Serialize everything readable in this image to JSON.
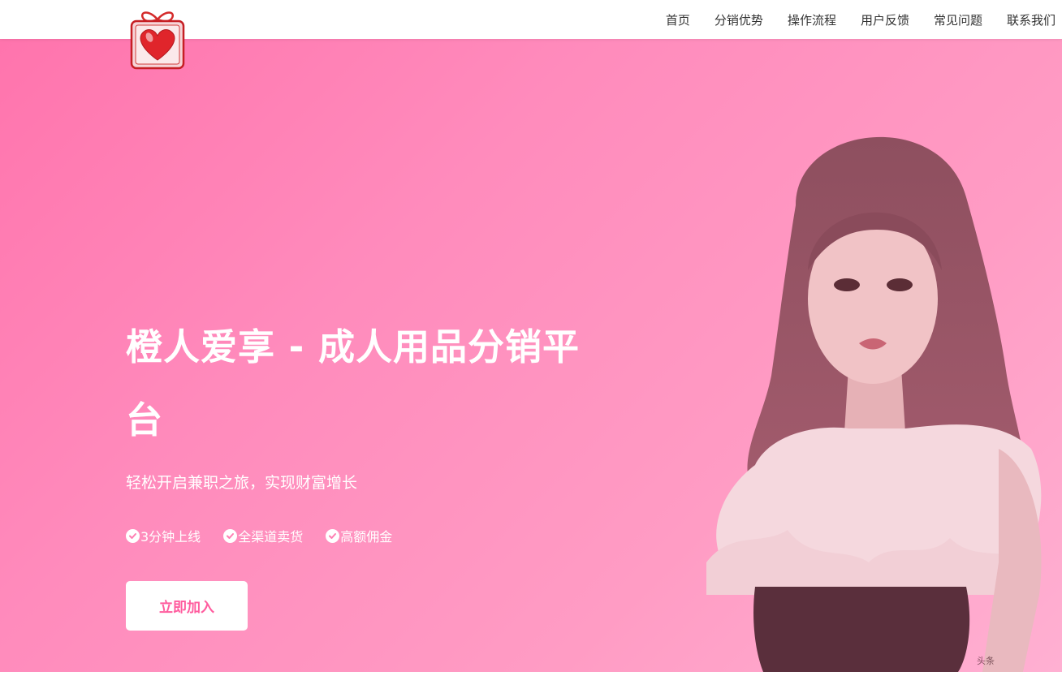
{
  "nav": {
    "items": [
      "首页",
      "分销优势",
      "操作流程",
      "用户反馈",
      "常见问题",
      "联系我们"
    ]
  },
  "logo": {
    "icon": "gift-heart-icon"
  },
  "hero": {
    "title": "橙人爱享 - 成人用品分销平台",
    "subtitle": "轻松开启兼职之旅，实现财富增长",
    "features": [
      {
        "icon": "check-circle-icon",
        "label": "3分钟上线"
      },
      {
        "icon": "check-circle-icon",
        "label": "全渠道卖货"
      },
      {
        "icon": "check-circle-icon",
        "label": "高额佣金"
      }
    ],
    "join_button": "立即加入",
    "watermark": "头条"
  },
  "colors": {
    "accent": "#ff5c9e",
    "gradient_start": "#ff74ad",
    "gradient_end": "#ffb0d2",
    "nav_text": "#333333"
  }
}
